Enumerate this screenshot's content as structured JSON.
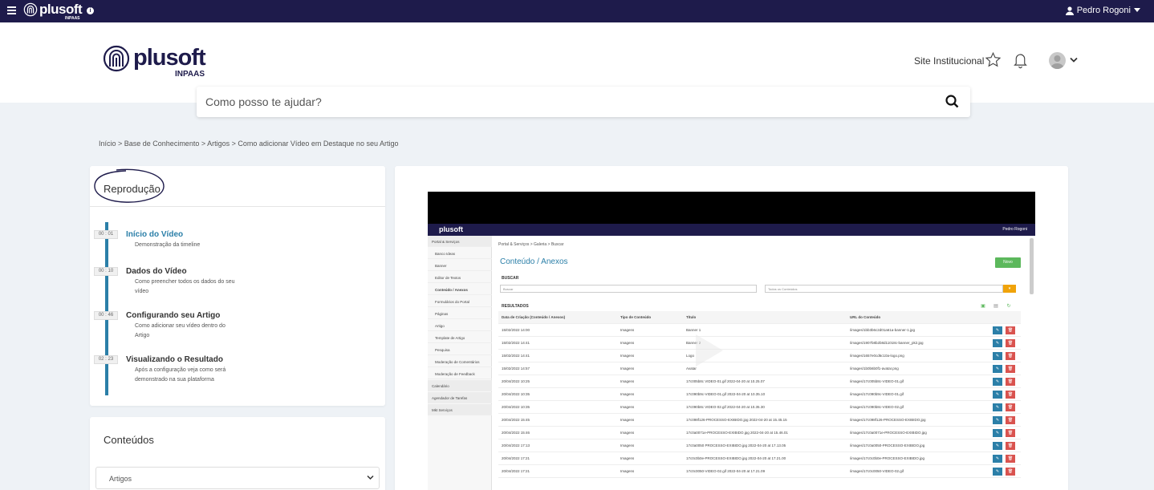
{
  "topbar": {
    "brand": "plusoft",
    "brand_sub": "INPAAS",
    "user_name": "Pedro Rogoni"
  },
  "header": {
    "brand": "plusoft",
    "brand_sub": "INPAAS",
    "site_link": "Site Institucional"
  },
  "search": {
    "placeholder": "Como posso te ajudar?"
  },
  "breadcrumb": "Início > Base de Conhecimento > Artigos > Como adicionar Vídeo em Destaque no seu Artigo",
  "reproducao": {
    "title": "Reprodução",
    "items": [
      {
        "time": "00 : 01",
        "title": "Início do Vídeo",
        "desc": "Demonstração da timeline"
      },
      {
        "time": "00 : 10",
        "title": "Dados do Vídeo",
        "desc": "Como preencher todos os dados do seu vídeo"
      },
      {
        "time": "00 : 46",
        "title": "Configurando seu Artigo",
        "desc": "Como adicionar seu vídeo dentro do Artigo"
      },
      {
        "time": "02 : 23",
        "title": "Visualizando o Resultado",
        "desc": "Após a configuração veja como será demonstrado na sua plataforma"
      }
    ]
  },
  "conteudos": {
    "title": "Conteúdos",
    "select_value": "Artigos"
  },
  "video": {
    "brand": "plusoft",
    "user": "Pedro Rogoni",
    "breadcrumb": "Portal & Serviços > Galeria > Buscar",
    "title": "Conteúdo / Anexos",
    "new_button": "Novo",
    "buscar_label": "BUSCAR",
    "buscar_placeholder": "Buscar",
    "tipo_value": "Todos os Conteúdos",
    "resultados_label": "RESULTADOS",
    "sidebar": [
      {
        "label": "Portal & Serviços",
        "head": true
      },
      {
        "label": "Banco Ideas"
      },
      {
        "label": "Banner"
      },
      {
        "label": "Editor de Textos"
      },
      {
        "label": "Conteúdo / Anexos",
        "sel": true
      },
      {
        "label": "Formulários do Portal"
      },
      {
        "label": "Páginas"
      },
      {
        "label": "Artigo"
      },
      {
        "label": "Template de Artigo"
      },
      {
        "label": "Pesquisa"
      },
      {
        "label": "Moderação de Comentários"
      },
      {
        "label": "Moderação de Feedback"
      },
      {
        "label": "Calendário",
        "head": true
      },
      {
        "label": "Agendador de Tarefas",
        "head": true
      },
      {
        "label": "Mkt Serviços",
        "head": true
      }
    ],
    "columns": [
      "Data de Criação (Conteúdo / Anexos)",
      "Tipo de Conteúdo",
      "Título",
      "URL do Conteúdo"
    ],
    "rows": [
      [
        "15/02/2022 14:00",
        "Imagens",
        "Banner 1",
        "/images/1bb3b6c2d01a61a-banner-1.jpg"
      ],
      [
        "15/02/2022 14:41",
        "Imagens",
        "Banner 2",
        "/images/1907b8b2b8d11018c-banner_pk2.jpg"
      ],
      [
        "15/02/2022 14:41",
        "Imagens",
        "Logo",
        "/images/1657e0cd6c10a-logo.png"
      ],
      [
        "15/02/2022 14:57",
        "Imagens",
        "Avatar",
        "/images/1b0b6b0f1-avatar.png"
      ],
      [
        "20/04/2022 10:25",
        "Imagens",
        "17c005b8c VIDEO-01.gif 2022-04-20 at 10.25.07",
        "/images/17c005b8c-VIDEO-01.gif"
      ],
      [
        "20/04/2022 10:35",
        "Imagens",
        "17c090b9c-VIDEO-01.gif 2022-04-20 at 10.35.10",
        "/images/17c090b9c-VIDEO-01.gif"
      ],
      [
        "20/04/2022 10:35",
        "Imagens",
        "17c090b8c VIDEO-02.gif 2022-04-20 at 10.35.30",
        "/images/17c090b8c-VIDEO-02.gif"
      ],
      [
        "20/04/2022 15:45",
        "Imagens",
        "17c098f126-PROCESSO-EXIBIDO.jpg 2022-04-20 at 15.45.15",
        "/images/17c098f126-PROCESSO-EXIBIDO.jpg"
      ],
      [
        "20/04/2022 15:46",
        "Imagens",
        "17c0a0071e-PROCESSO-EXIBIDO.jpg 2022-04-20 at 15.46.01",
        "/images/17c0a0071e-PROCESSO-EXIBIDO.jpg"
      ],
      [
        "20/04/2022 17:13",
        "Imagens",
        "17c0a0050 PROCESSO-EXIBIDO.jpg 2022-04-20 at 17.13.05",
        "/images/17c0a0050-PROCESSO-EXIBIDO.jpg"
      ],
      [
        "20/04/2022 17:21",
        "Imagens",
        "17c0c0b0e-PROCESSO-EXIBIDO.jpg 2022-04-20 at 17.21.00",
        "/images/17c0c0b0e-PROCESSO-EXIBIDO.jpg"
      ],
      [
        "20/04/2022 17:21",
        "Imagens",
        "17c0c0050-VIDEO-02.gif 2022-04-20 at 17.21.09",
        "/images/17c0c0050-VIDEO-02.gif"
      ]
    ]
  }
}
